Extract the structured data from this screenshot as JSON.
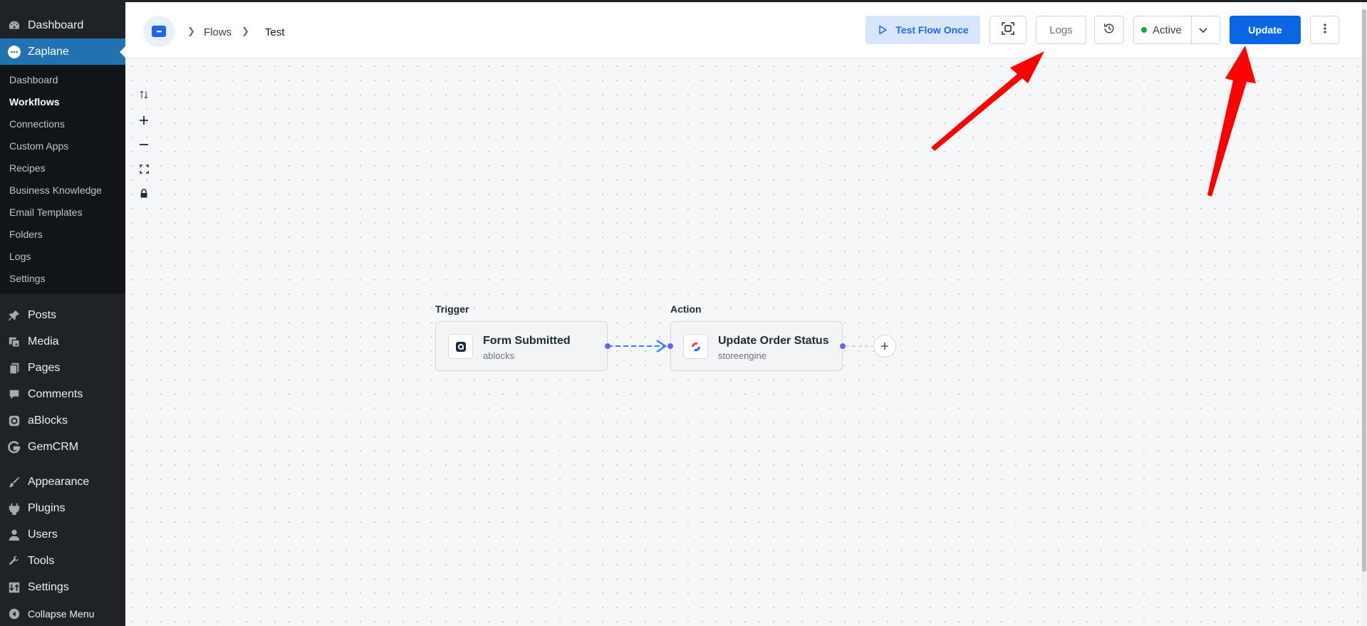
{
  "sidebar": {
    "top_items": [
      {
        "label": "Dashboard",
        "icon": "dashboard-icon"
      },
      {
        "label": "Zaplane",
        "icon": "zaplane-icon"
      }
    ],
    "submenu": [
      {
        "label": "Dashboard"
      },
      {
        "label": "Workflows"
      },
      {
        "label": "Connections"
      },
      {
        "label": "Custom Apps"
      },
      {
        "label": "Recipes"
      },
      {
        "label": "Business Knowledge"
      },
      {
        "label": "Email Templates"
      },
      {
        "label": "Folders"
      },
      {
        "label": "Logs"
      },
      {
        "label": "Settings"
      }
    ],
    "group1": [
      {
        "label": "Posts",
        "icon": "pin-icon"
      },
      {
        "label": "Media",
        "icon": "media-icon"
      },
      {
        "label": "Pages",
        "icon": "pages-icon"
      },
      {
        "label": "Comments",
        "icon": "comment-icon"
      },
      {
        "label": "aBlocks",
        "icon": "ablocks-icon"
      },
      {
        "label": "GemCRM",
        "icon": "gemcrm-icon"
      }
    ],
    "group2": [
      {
        "label": "Appearance",
        "icon": "brush-icon"
      },
      {
        "label": "Plugins",
        "icon": "plugin-icon"
      },
      {
        "label": "Users",
        "icon": "user-icon"
      },
      {
        "label": "Tools",
        "icon": "wrench-icon"
      },
      {
        "label": "Settings",
        "icon": "settings-icon"
      },
      {
        "label": "Collapse Menu",
        "icon": "collapse-icon"
      }
    ]
  },
  "header": {
    "breadcrumb": [
      "Flows",
      "Test"
    ],
    "test_flow_label": "Test Flow Once",
    "logs_label": "Logs",
    "status_label": "Active",
    "update_label": "Update"
  },
  "flow": {
    "trigger_label": "Trigger",
    "action_label": "Action",
    "trigger": {
      "title": "Form Submitted",
      "app": "ablocks"
    },
    "action": {
      "title": "Update Order Status",
      "app": "storeengine"
    }
  },
  "colors": {
    "accent": "#2271b1",
    "primary_button": "#0a66e4",
    "status_active": "#16a34a",
    "annotation_arrow": "#ff0000"
  }
}
